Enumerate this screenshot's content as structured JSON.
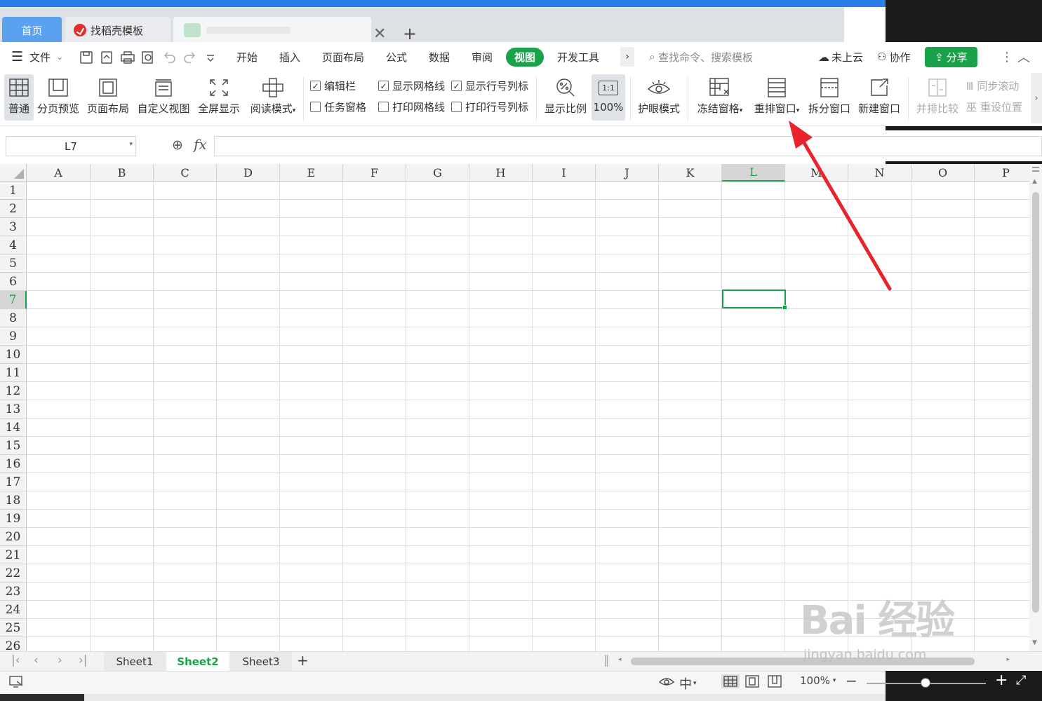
{
  "tabs": {
    "home": "首页",
    "doc": "找稻壳模板"
  },
  "menu": {
    "file": "文件",
    "items": [
      "开始",
      "插入",
      "页面布局",
      "公式",
      "数据",
      "审阅",
      "视图",
      "开发工具"
    ],
    "search_placeholder": "查找命令、搜索模板",
    "cloud": "未上云",
    "collab": "协作",
    "share": "分享"
  },
  "toolbar": {
    "normal": "普通",
    "page_break_preview": "分页预览",
    "page_layout": "页面布局",
    "custom_view": "自定义视图",
    "full_screen": "全屏显示",
    "reading_mode": "阅读模式",
    "edit_bar": "编辑栏",
    "task_pane": "任务窗格",
    "show_gridlines": "显示网格线",
    "print_gridlines": "打印网格线",
    "show_headers": "显示行号列标",
    "print_headers": "打印行号列标",
    "zoom": "显示比例",
    "zoom_100": "100%",
    "zoom_100_icon": "1:1",
    "eye_mode": "护眼模式",
    "freeze_panes": "冻结窗格",
    "rearrange_windows": "重排窗口",
    "split_window": "拆分窗口",
    "new_window": "新建窗口",
    "side_by_side": "并排比较",
    "sync_scroll": "同步滚动",
    "reset_position": "重设位置",
    "checks": {
      "edit_bar": true,
      "task_pane": false,
      "show_gridlines": true,
      "print_gridlines": false,
      "show_headers": true,
      "print_headers": false
    }
  },
  "formula_bar": {
    "name_box": "L7",
    "fx": "fx",
    "content": ""
  },
  "grid": {
    "columns": [
      "A",
      "B",
      "C",
      "D",
      "E",
      "F",
      "G",
      "H",
      "I",
      "J",
      "K",
      "L",
      "M",
      "N",
      "O",
      "P"
    ],
    "rows": [
      "1",
      "2",
      "3",
      "4",
      "5",
      "6",
      "7",
      "8",
      "9",
      "10",
      "11",
      "12",
      "13",
      "14",
      "15",
      "16",
      "17",
      "18",
      "19",
      "20",
      "21",
      "22",
      "23",
      "24",
      "25",
      "26"
    ],
    "selected_column": "L",
    "selected_row": "7"
  },
  "sheets": [
    "Sheet1",
    "Sheet2",
    "Sheet3"
  ],
  "active_sheet": "Sheet2",
  "status": {
    "zoom": "100%",
    "zoom_fraction": 0.5
  },
  "watermark": {
    "brand": "Bai 经验",
    "url": "jingyan.baidu.com"
  },
  "colors": {
    "accent": "#1aa24a",
    "annotation_arrow": "#e8232b",
    "title_bar": "#2a7ee8"
  }
}
